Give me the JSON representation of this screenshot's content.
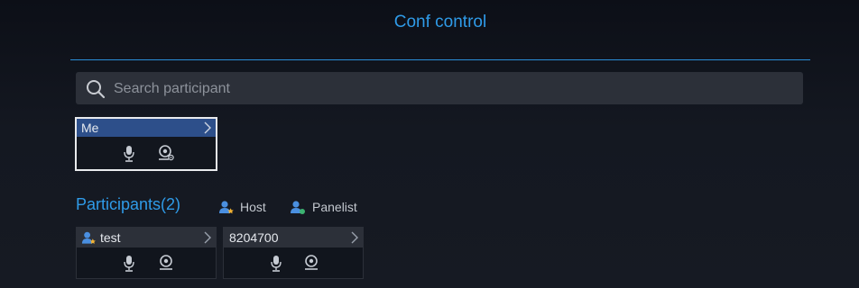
{
  "header": {
    "title": "Conf control"
  },
  "search": {
    "placeholder": "Search participant",
    "value": ""
  },
  "me_card": {
    "name": "Me"
  },
  "participants": {
    "label": "Participants(2)",
    "legend": [
      {
        "label": "Host",
        "icon": "host-user-icon",
        "color": "#4a8fe0"
      },
      {
        "label": "Panelist",
        "icon": "panelist-user-icon",
        "color": "#4a8fe0"
      }
    ],
    "items": [
      {
        "name": "test",
        "role_icon": "host-user-icon"
      },
      {
        "name": "8204700"
      }
    ]
  },
  "colors": {
    "accent": "#2f9be8",
    "selected_header": "#2d4f8a",
    "background": "#141821"
  }
}
